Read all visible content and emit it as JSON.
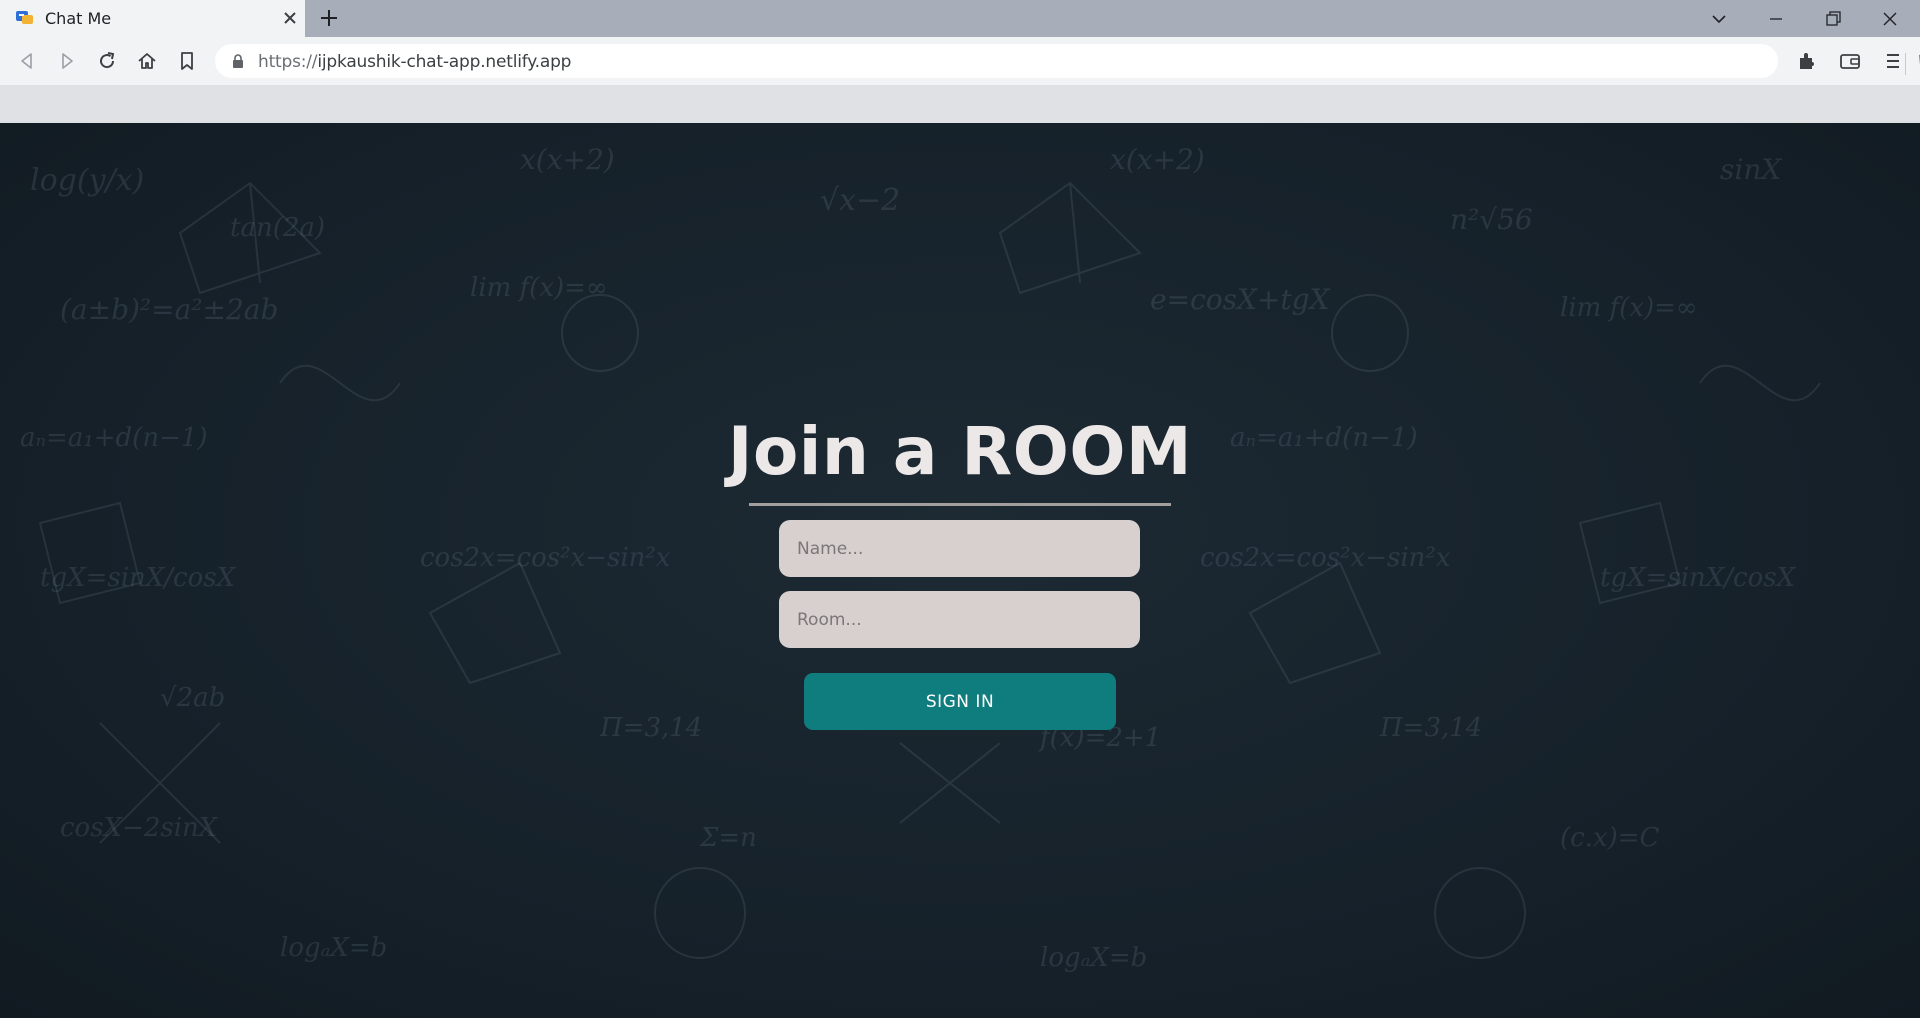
{
  "browser": {
    "tab": {
      "title": "Chat Me",
      "favicon": "chat-app-favicon",
      "close_icon": "close-icon"
    },
    "new_tab_icon": "plus-icon",
    "window_controls": [
      "tab-search-icon",
      "minimize-icon",
      "restore-icon",
      "close-window-icon"
    ],
    "nav": [
      "back-icon",
      "forward-icon",
      "reload-icon",
      "home-icon",
      "bookmark-icon"
    ],
    "url": {
      "scheme": "https://",
      "host": "ijpkaushik-chat-app.netlify.app"
    },
    "omnibox_icons": [
      "brave-shields-icon",
      "brave-rewards-icon"
    ],
    "toolbar_icons": [
      "extensions-icon",
      "wallet-icon",
      "menu-icon"
    ]
  },
  "page": {
    "title": "Join a ROOM",
    "name_field": {
      "placeholder": "Name...",
      "value": ""
    },
    "room_field": {
      "placeholder": "Room...",
      "value": ""
    },
    "submit_label": "SIGN IN",
    "colors": {
      "background": "#16212a",
      "button": "#0f7c7e",
      "field": "#d8cfcf",
      "title": "#ece8e8"
    }
  }
}
